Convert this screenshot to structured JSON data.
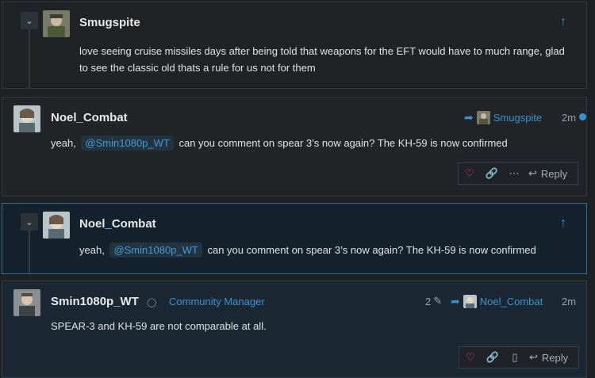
{
  "quote1": {
    "username": "Smugspite",
    "text": "love seeing cruise missiles days after being told that weapons for the EFT would have to much range, glad to see the classic old thats a rule for us not for them"
  },
  "post1": {
    "username": "Noel_Combat",
    "reply_to": "Smugspite",
    "time": "2m",
    "text_before": "yeah,",
    "mention": "@Smin1080p_WT",
    "text_after": "can you comment on spear 3’s now again? The KH-59 is now confirmed",
    "reply_label": "Reply"
  },
  "quote2": {
    "username": "Noel_Combat",
    "text_before": "yeah,",
    "mention": "@Smin1080p_WT",
    "text_after": "can you comment on spear 3’s now again? The KH-59 is now confirmed"
  },
  "post2": {
    "username": "Smin1080p_WT",
    "role": "Community Manager",
    "edits": "2",
    "reply_to": "Noel_Combat",
    "time": "2m",
    "text": "SPEAR-3 and KH-59 are not comparable at all.",
    "reply_label": "Reply"
  }
}
